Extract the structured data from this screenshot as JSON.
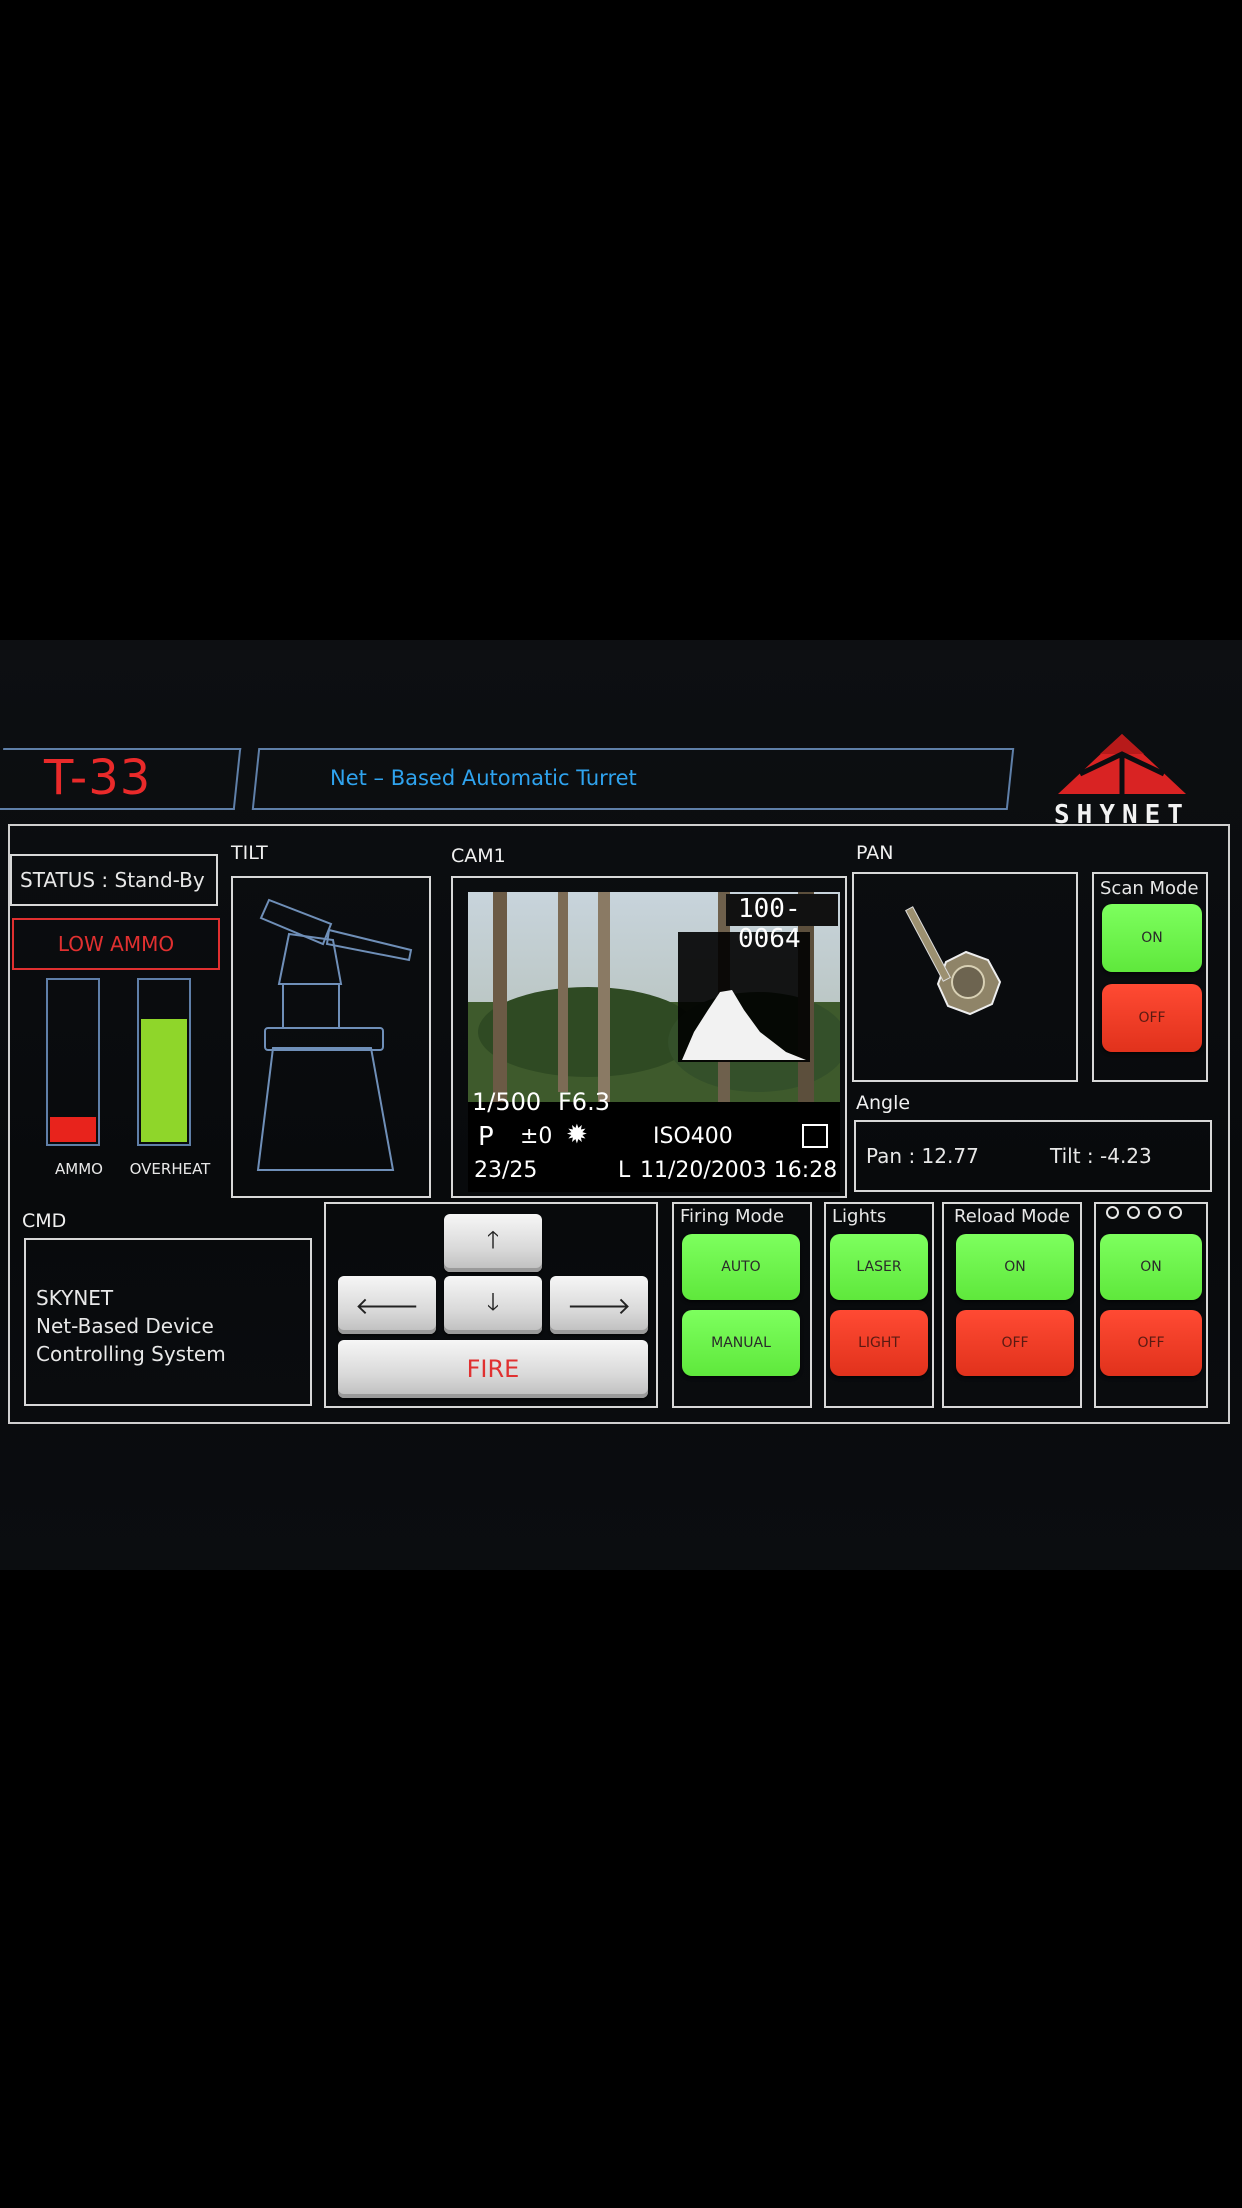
{
  "header": {
    "title": "T-33",
    "subtitle": "Net – Based Automatic Turret",
    "logo_text": "SHYNET"
  },
  "status": {
    "text": "STATUS : Stand-By",
    "warning": "LOW AMMO"
  },
  "gauges": [
    {
      "label": "AMMO",
      "level": 0.15,
      "color": "#e8231c"
    },
    {
      "label": "OVERHEAT",
      "level": 0.75,
      "color": "#8fd62a"
    }
  ],
  "tilt": {
    "label": "TILT"
  },
  "camera": {
    "label": "CAM1",
    "folder": "100-0064",
    "shutter": "1/500",
    "aperture": "F6.3",
    "mode": "P",
    "exposure": "±0",
    "iso": "ISO400",
    "frame": "23/25",
    "quality": "L",
    "datetime": "11/20/2003 16:28"
  },
  "pan": {
    "label": "PAN"
  },
  "scan_mode": {
    "title": "Scan Mode",
    "on": "ON",
    "off": "OFF"
  },
  "angle": {
    "label": "Angle",
    "pan": "Pan : 12.77",
    "tilt": "Tilt : -4.23"
  },
  "cmd": {
    "label": "CMD",
    "lines": [
      "SKYNET",
      "Net-Based Device",
      "Controlling System"
    ]
  },
  "controls": {
    "up_icon": "arrow-up-icon",
    "down_icon": "arrow-down-icon",
    "left_icon": "arrow-left-icon",
    "right_icon": "arrow-right-icon",
    "fire": "FIRE"
  },
  "firing_mode": {
    "title": "Firing Mode",
    "auto": "AUTO",
    "manual": "MANUAL"
  },
  "lights": {
    "title": "Lights",
    "laser": "LASER",
    "light": "LIGHT"
  },
  "reload_mode": {
    "title": "Reload Mode",
    "on": "ON",
    "off": "OFF"
  },
  "extra_panel": {
    "on": "ON",
    "off": "OFF"
  },
  "colors": {
    "title_red": "#ea2a2a",
    "accent_blue": "#2fa3ee",
    "button_green": "#6cf34a",
    "button_red": "#ee3a24"
  }
}
